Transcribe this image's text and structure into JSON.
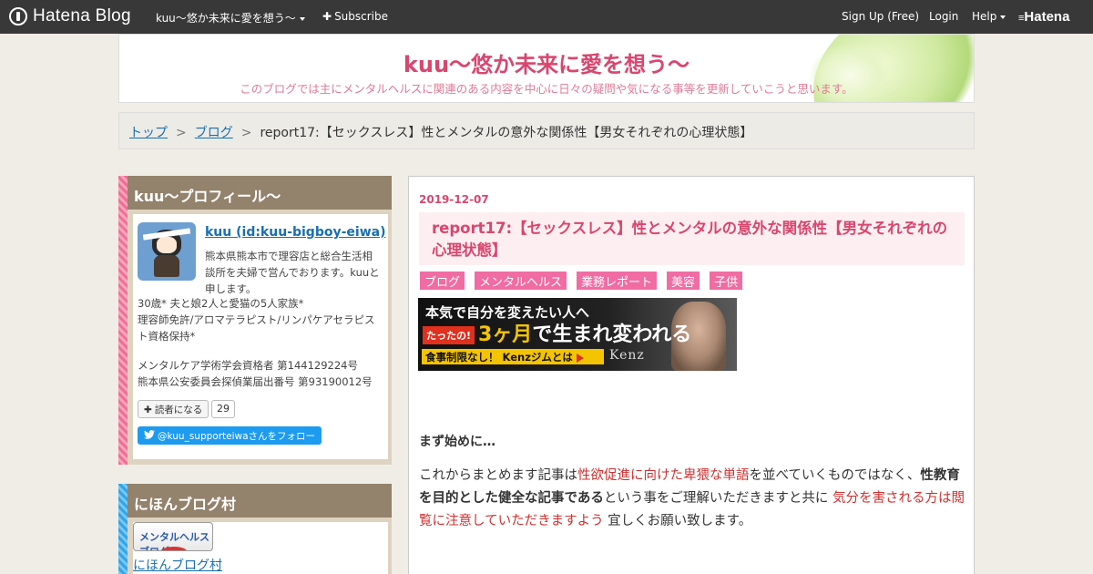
{
  "topbar": {
    "logo": "Hatena Blog",
    "blog_menu": "kuu～悠か未来に愛を想う～",
    "subscribe": "Subscribe",
    "signup": "Sign Up (Free)",
    "login": "Login",
    "help": "Help",
    "brand": "Hatena"
  },
  "header": {
    "title": "kuu～悠か未来に愛を想う～",
    "description": "このブログでは主にメンタルヘルスに関連のある内容を中心に日々の疑問や気になる事等を更新していこうと思います。"
  },
  "breadcrumb": {
    "top": "トップ",
    "sep": ">",
    "blog": "ブログ",
    "current": "report17:【セックスレス】性とメンタルの意外な関係性【男女それぞれの心理状態】"
  },
  "profile": {
    "title": "kuu～プロフィール～",
    "name": "kuu (id:kuu-bigboy-eiwa)",
    "text1": "熊本県熊本市で理容店と総合生活相談所を夫婦で営んでおります。kuuと申します。",
    "text2": "30歳* 夫と娘2人と愛猫の5人家族*\n理容師免許/アロマテラピスト/リンパケアセラピスト資格保持*",
    "text3": "メンタルケア学術学会資格者 第144129224号\n熊本県公安委員会探偵業届出番号 第93190012号",
    "reader_button": "読者になる",
    "reader_count": "29",
    "twitter": "@kuu_supporteiwaさんをフォロー"
  },
  "village": {
    "title": "にほんブログ村",
    "badge": "メンタルヘルスブログ",
    "link": "にほんブログ村"
  },
  "entry": {
    "date": "2019-12-07",
    "title": "report17:【セックスレス】性とメンタルの意外な関係性【男女それぞれの心理状態】",
    "categories": [
      "ブログ",
      "メンタルヘルス",
      "業務レポート",
      "美容",
      "子供"
    ],
    "banner": {
      "line1": "本気で自分を変えたい人へ",
      "tag": "たったの!",
      "main_a": "3ヶ月",
      "main_b": "で生まれ変われる",
      "cta": "食事制限なし！ Kenzジムとは",
      "brand": "Kenz"
    },
    "section_head": "まず始めに…",
    "p1": "これからまとめます記事は",
    "p2": "性欲促進に向けた卑猥な単語",
    "p3": "を並べていくものではなく、",
    "p4": "性教育を目的とした健全な記事である",
    "p5": "という事をご理解いただきますと共に ",
    "p6": "気分を害される方は閲覧に注意していただきますよう",
    "p7": " 宜しくお願い致します。"
  },
  "colors": {
    "accent": "#d9466e",
    "category": "#f06ca3",
    "module_header": "#93826c",
    "link": "#1a6fb0"
  }
}
